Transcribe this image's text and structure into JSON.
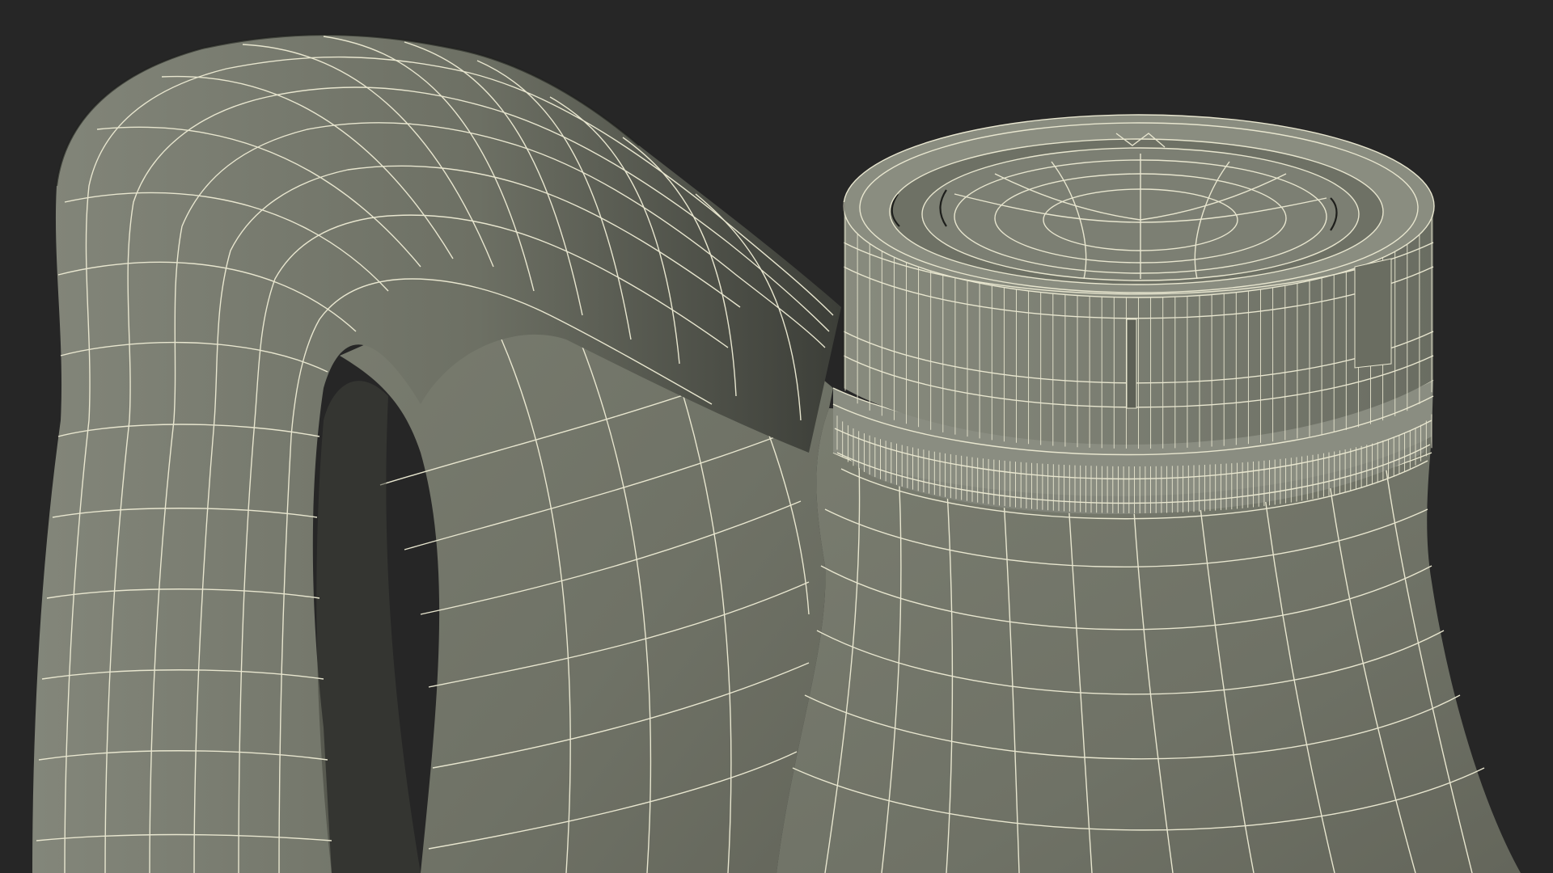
{
  "scene": {
    "background_color": "#262626",
    "surface_color": "#777a6d",
    "surface_shadow_color": "#4a4c44",
    "wire_color": "#e8e6cf",
    "subject": [
      {
        "part": "handle",
        "icon": "jug-handle-mesh"
      },
      {
        "part": "cap",
        "icon": "bottle-cap-mesh"
      },
      {
        "part": "neck-ring",
        "icon": "knurled-ring-mesh"
      },
      {
        "part": "body",
        "icon": "jug-body-mesh"
      }
    ]
  }
}
